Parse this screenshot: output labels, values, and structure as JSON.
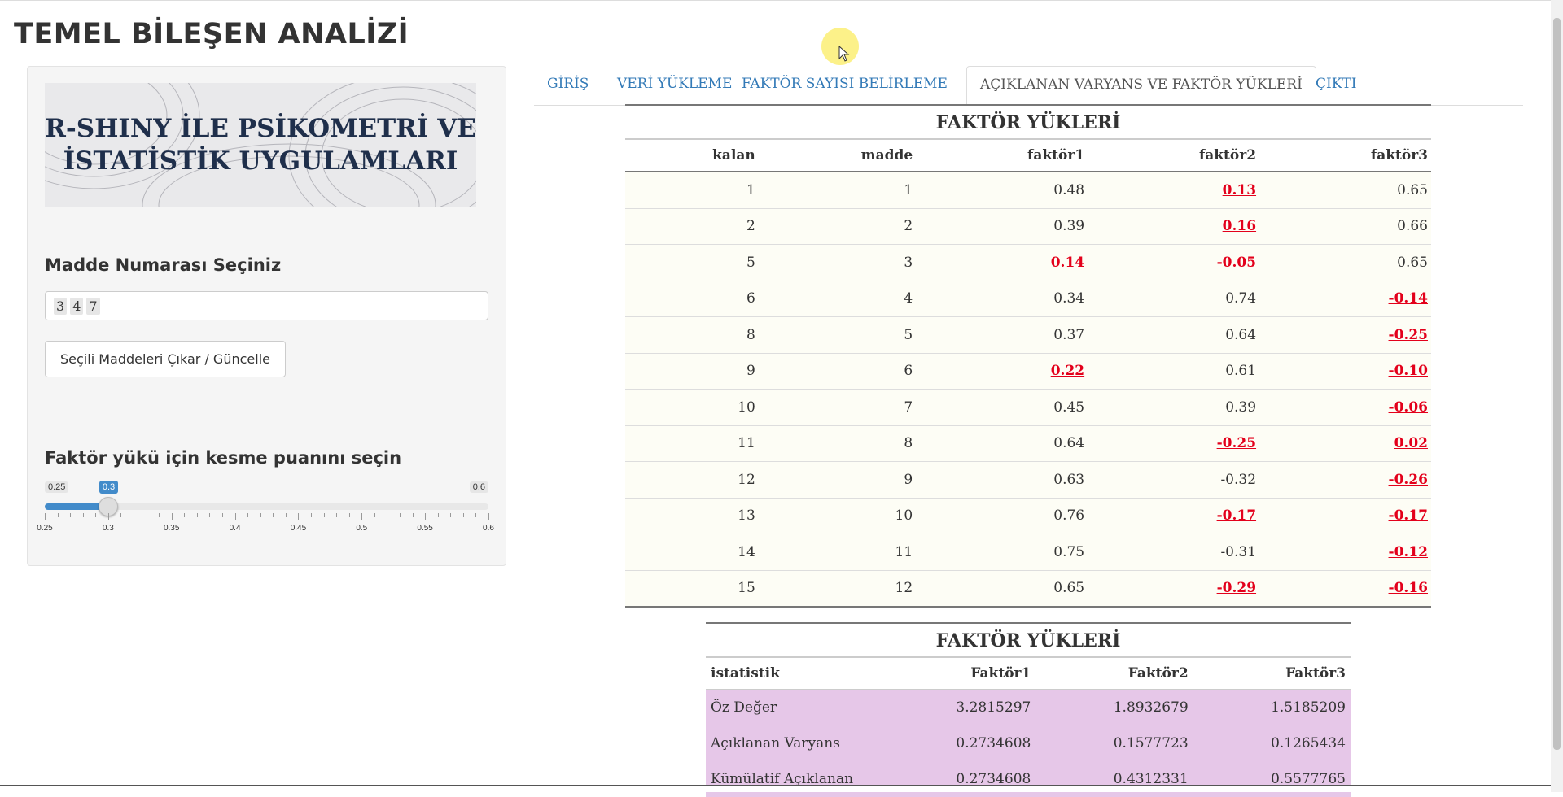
{
  "app_title": "TEMEL BİLEŞEN ANALİZİ",
  "sidebar": {
    "banner_line1": "R-SHINY İLE PSİKOMETRİ VE",
    "banner_line2": "İSTATİSTİK UYGULAMLARI",
    "item_select_label": "Madde Numarası Seçiniz",
    "selected_items": [
      "3",
      "4",
      "7"
    ],
    "update_button": "Seçili Maddeleri Çıkar / Güncelle",
    "cutoff_label": "Faktör yükü için kesme puanını seçin",
    "slider": {
      "min": 0.25,
      "max": 0.6,
      "value": 0.3,
      "min_label": "0.25",
      "max_label": "0.6",
      "value_label": "0.3",
      "tick_labels": [
        "0.25",
        "0.3",
        "0.35",
        "0.4",
        "0.45",
        "0.5",
        "0.55",
        "0.6"
      ],
      "accent": "#428bca"
    }
  },
  "tabs": [
    {
      "label": "GİRİŞ",
      "active": false
    },
    {
      "label": "VERİ YÜKLEME",
      "active": false
    },
    {
      "label": "FAKTÖR SAYISI BELİRLEME",
      "active": false
    },
    {
      "label": "AÇIKLANAN VARYANS VE FAKTÖR YÜKLERİ",
      "active": true
    },
    {
      "label": "ÇIKTI",
      "active": false
    }
  ],
  "loadings_table": {
    "caption": "FAKTÖR YÜKLERİ",
    "columns": [
      "kalan",
      "madde",
      "faktör1",
      "faktör2",
      "faktör3"
    ],
    "highlight_color": "#e3001b",
    "rows": [
      {
        "cells": [
          "1",
          "1",
          "0.48",
          "0.13",
          "0.65"
        ],
        "low": [
          false,
          false,
          false,
          true,
          false
        ]
      },
      {
        "cells": [
          "2",
          "2",
          "0.39",
          "0.16",
          "0.66"
        ],
        "low": [
          false,
          false,
          false,
          true,
          false
        ]
      },
      {
        "cells": [
          "5",
          "3",
          "0.14",
          "-0.05",
          "0.65"
        ],
        "low": [
          false,
          false,
          true,
          true,
          false
        ]
      },
      {
        "cells": [
          "6",
          "4",
          "0.34",
          "0.74",
          "-0.14"
        ],
        "low": [
          false,
          false,
          false,
          false,
          true
        ]
      },
      {
        "cells": [
          "8",
          "5",
          "0.37",
          "0.64",
          "-0.25"
        ],
        "low": [
          false,
          false,
          false,
          false,
          true
        ]
      },
      {
        "cells": [
          "9",
          "6",
          "0.22",
          "0.61",
          "-0.10"
        ],
        "low": [
          false,
          false,
          true,
          false,
          true
        ]
      },
      {
        "cells": [
          "10",
          "7",
          "0.45",
          "0.39",
          "-0.06"
        ],
        "low": [
          false,
          false,
          false,
          false,
          true
        ]
      },
      {
        "cells": [
          "11",
          "8",
          "0.64",
          "-0.25",
          "0.02"
        ],
        "low": [
          false,
          false,
          false,
          true,
          true
        ]
      },
      {
        "cells": [
          "12",
          "9",
          "0.63",
          "-0.32",
          "-0.26"
        ],
        "low": [
          false,
          false,
          false,
          false,
          true
        ]
      },
      {
        "cells": [
          "13",
          "10",
          "0.76",
          "-0.17",
          "-0.17"
        ],
        "low": [
          false,
          false,
          false,
          true,
          true
        ]
      },
      {
        "cells": [
          "14",
          "11",
          "0.75",
          "-0.31",
          "-0.12"
        ],
        "low": [
          false,
          false,
          false,
          false,
          true
        ]
      },
      {
        "cells": [
          "15",
          "12",
          "0.65",
          "-0.29",
          "-0.16"
        ],
        "low": [
          false,
          false,
          false,
          true,
          true
        ]
      }
    ]
  },
  "variance_table": {
    "caption": "FAKTÖR YÜKLERİ",
    "columns": [
      "istatistik",
      "Faktör1",
      "Faktör2",
      "Faktör3"
    ],
    "row_color": "#e6c7e8",
    "rows": [
      [
        "Öz Değer",
        "3.2815297",
        "1.8932679",
        "1.5185209"
      ],
      [
        "Açıklanan Varyans",
        "0.2734608",
        "0.1577723",
        "0.1265434"
      ],
      [
        "Kümülatif Açıklanan",
        "0.2734608",
        "0.4312331",
        "0.5577765"
      ]
    ]
  }
}
